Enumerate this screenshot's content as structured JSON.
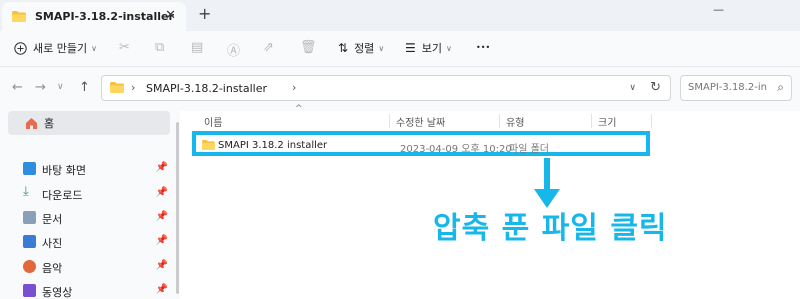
{
  "tab": {
    "title": "SMAPI-3.18.2-installer",
    "close_glyph": "✕",
    "add_glyph": "+"
  },
  "window": {
    "minimize_glyph": "—"
  },
  "toolbar": {
    "new_label": "새로 만들기",
    "sort_label": "정렬",
    "view_label": "보기",
    "more_glyph": "•••"
  },
  "address": {
    "path": "SMAPI-3.18.2-installer",
    "separator": "›",
    "search_placeholder": "SMAPI-3.18.2-in..."
  },
  "sidebar": {
    "home_label": "홈",
    "items": [
      {
        "label": "바탕 화면",
        "icon": "desktop-icon",
        "color": "#2f8de0"
      },
      {
        "label": "다운로드",
        "icon": "download-icon",
        "color": "#2aa05b"
      },
      {
        "label": "문서",
        "icon": "document-icon",
        "color": "#8aa0b8"
      },
      {
        "label": "사진",
        "icon": "pictures-icon",
        "color": "#3a7bd5"
      },
      {
        "label": "음악",
        "icon": "music-icon",
        "color": "#e0683a"
      },
      {
        "label": "동영상",
        "icon": "video-icon",
        "color": "#7a4fd0"
      }
    ]
  },
  "columns": {
    "name": "이름",
    "date": "수정한 날짜",
    "type": "유형",
    "size": "크기"
  },
  "files": [
    {
      "name": "SMAPI 3.18.2 installer",
      "date": "2023-04-09 오후 10:20",
      "type": "파일 폴더"
    }
  ],
  "annotation": {
    "text": "압축 푼 파일 클릭",
    "color": "#17b7ea"
  }
}
